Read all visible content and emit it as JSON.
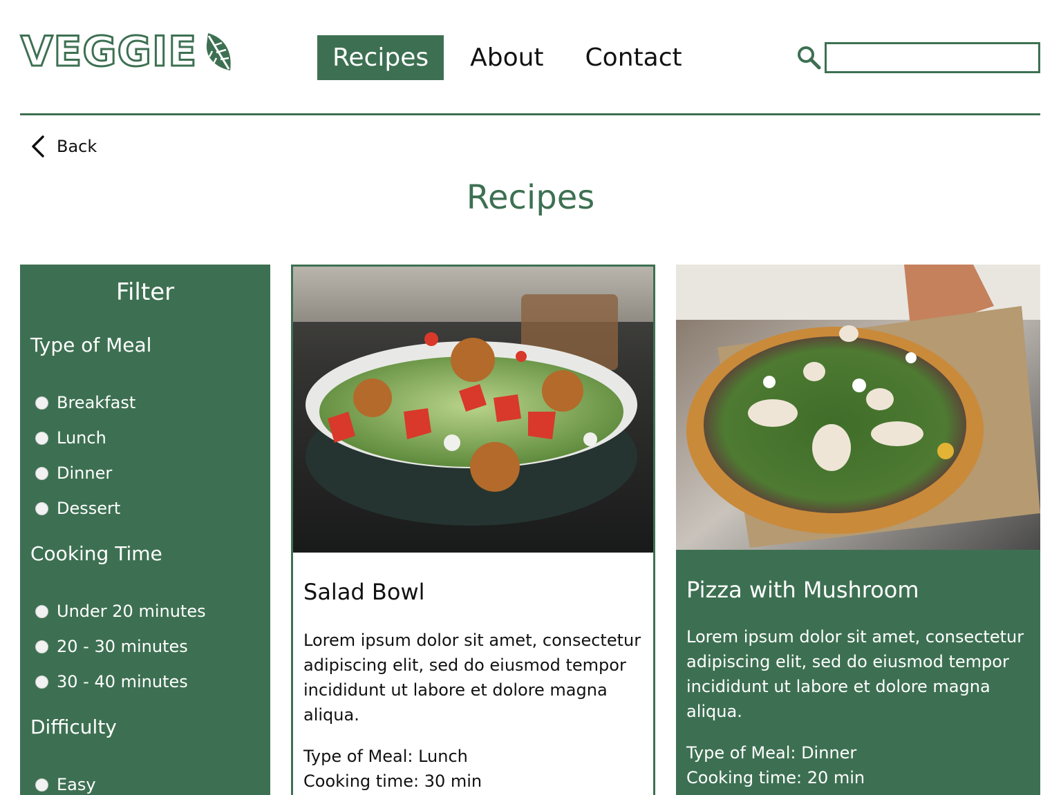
{
  "brand": {
    "name": "VEGGIE",
    "color": "#3d7052"
  },
  "nav": {
    "items": [
      "Recipes",
      "About",
      "Contact"
    ],
    "active": "Recipes"
  },
  "search": {
    "placeholder": "",
    "value": ""
  },
  "back": {
    "label": "Back"
  },
  "page": {
    "title": "Recipes"
  },
  "filter": {
    "title": "Filter",
    "groups": [
      {
        "title": "Type of Meal",
        "options": [
          "Breakfast",
          "Lunch",
          "Dinner",
          "Dessert"
        ]
      },
      {
        "title": "Cooking Time",
        "options": [
          "Under 20 minutes",
          "20 - 30 minutes",
          "30 - 40 minutes"
        ]
      },
      {
        "title": "Difficulty",
        "options": [
          "Easy"
        ]
      }
    ]
  },
  "recipes": [
    {
      "title": "Salad Bowl",
      "description": "Lorem ipsum dolor sit amet, consectetur adipiscing elit, sed do eiusmod tempor incididunt ut labore et dolore magna aliqua.",
      "meal_type": "Type of Meal: Lunch",
      "cooking_time": "Cooking time: 30 min",
      "image": "salad-bowl-photo"
    },
    {
      "title": "Pizza with Mushroom",
      "description": "Lorem ipsum dolor sit amet, consectetur adipiscing elit, sed do eiusmod tempor incididunt ut labore et dolore magna aliqua.",
      "meal_type": "Type of Meal: Dinner",
      "cooking_time": "Cooking time: 20 min",
      "image": "mushroom-pizza-photo"
    }
  ]
}
